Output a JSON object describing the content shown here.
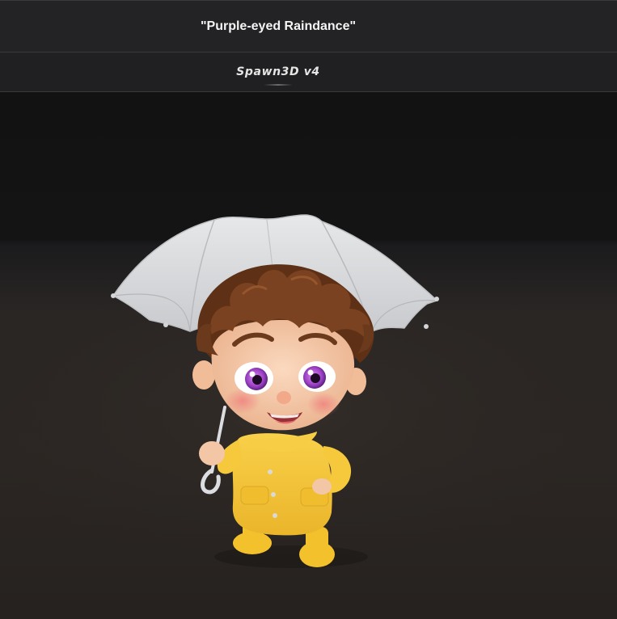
{
  "header": {
    "title": "\"Purple-eyed Raindance\""
  },
  "model_bar": {
    "model_label": "Spawn3D v4"
  },
  "viewport": {
    "subject": "3D cartoon child in yellow raincoat holding a white umbrella",
    "colors": {
      "raincoat": "#f5c534",
      "umbrella": "#d9dadc",
      "hair": "#6b3a1c",
      "eyes": "#9b3fc4",
      "skin": "#f6c9a8",
      "backdrop_top": "#121212",
      "floor": "#2b2623"
    }
  }
}
